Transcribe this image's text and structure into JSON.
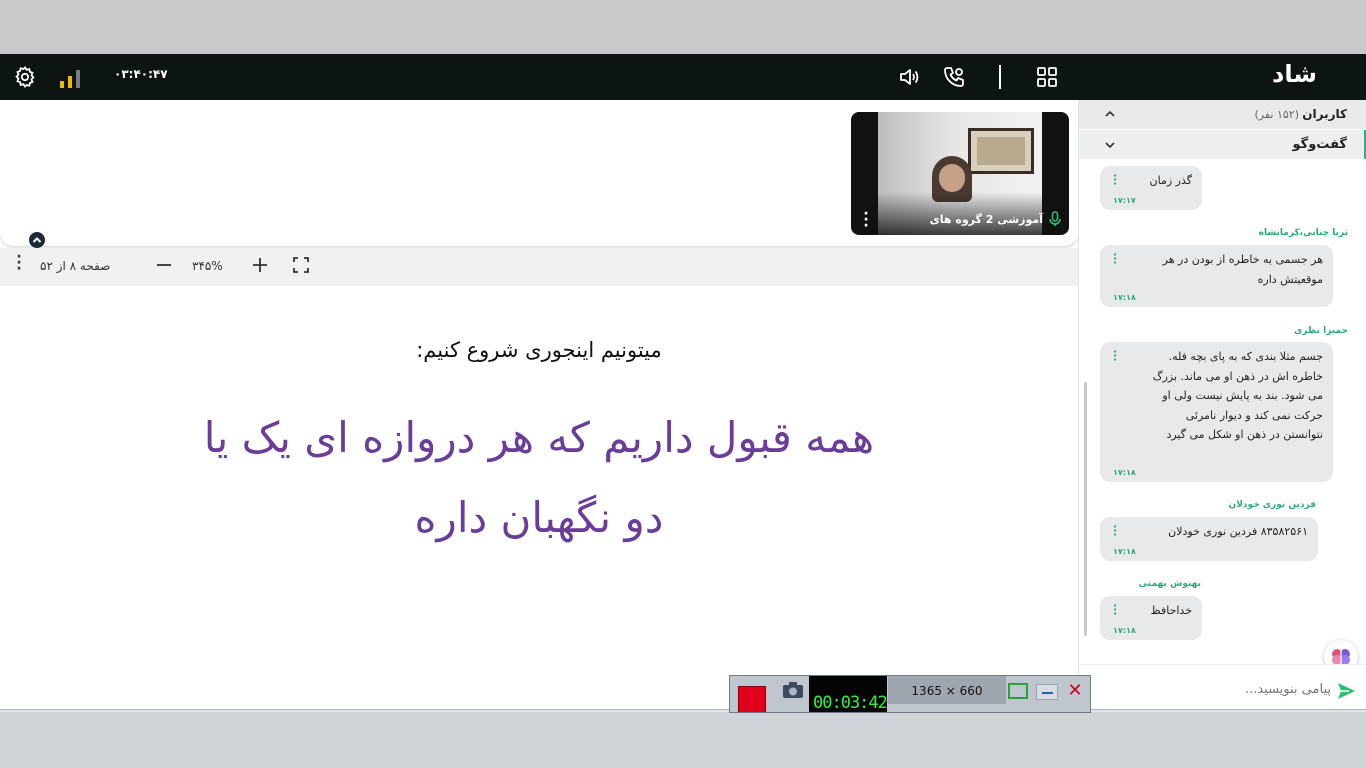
{
  "header": {
    "timer": "۰۳:۴۰:۴۷",
    "logo": "شاد"
  },
  "video": {
    "participant_name": "آموزشی 2 گروه های"
  },
  "presentation": {
    "page_indicator": "صفحه ۸ از ۵۲",
    "zoom_level": "۳۴۵%",
    "slide": {
      "subtitle": "میتونیم اینجوری شروع کنیم:",
      "main_text": "همه قبول داریم که هر دروازه ای یک یا دو نگهبان داره"
    }
  },
  "sidebar": {
    "users_label": "کاربران",
    "users_count": "(۱۵۲ نفر)",
    "chat_label": "گفت‌وگو",
    "messages": [
      {
        "author": "",
        "text": "گذر زمان",
        "time": "۱۷:۱۷"
      },
      {
        "author": "ثریا چنانی،کرمانشاه",
        "text": "هر جسمی یه خاطره از بودن در هر موقعیتش داره",
        "time": "۱۷:۱۸"
      },
      {
        "author": "حمیرا نظری",
        "text": "جسم مثلا بندی که به پای بچه فله. خاطره اش در ذهن او می ماند. بزرگ می شود. بند به پایش نیست ولی او حرکت نمی کند و دیوار نامرئی نتوانستن در ذهن او شکل می گیرد",
        "time": "۱۷:۱۸"
      },
      {
        "author": "فردین نوری خودلان",
        "text": "۸۳۵۸۲۵۶۱ فردین نوری خودلان",
        "time": "۱۷:۱۸"
      },
      {
        "author": "بهنوش بهمنی",
        "text": "خداحافظ",
        "time": "۱۷:۱۸"
      }
    ],
    "input_placeholder": "پیامی بنویسید..."
  },
  "recorder": {
    "elapsed": "00:03:42",
    "resolution": "1365 × 660"
  },
  "colors": {
    "header_bg": "#0d1512",
    "accent": "#2fa979",
    "slide_text": "#6a3d98",
    "record": "#e3001b"
  },
  "icons": [
    "gear-icon",
    "signal-bars-icon",
    "speaker-icon",
    "phone-icon",
    "grid-icon",
    "mic-icon",
    "kebab-icon",
    "chevron-up-icon",
    "minus-icon",
    "plus-icon",
    "fullscreen-icon",
    "send-icon",
    "brain-icon",
    "camera-icon"
  ]
}
